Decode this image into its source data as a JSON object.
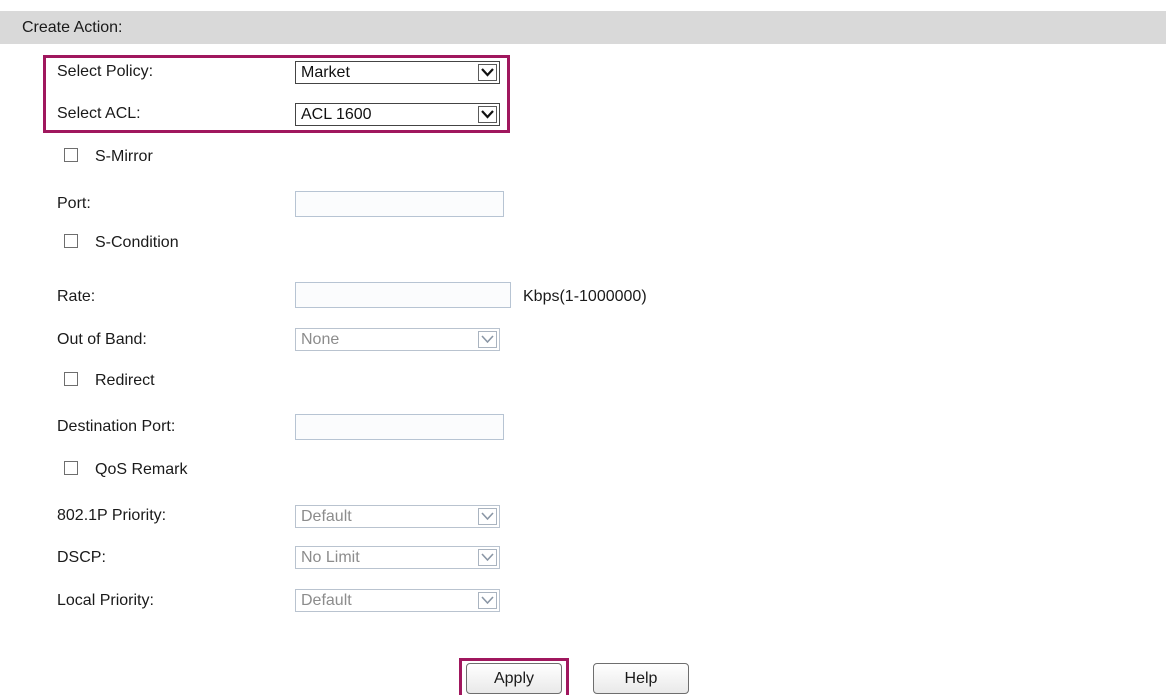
{
  "section": {
    "title": "Create Action:"
  },
  "form": {
    "select_policy": {
      "label": "Select Policy:",
      "value": "Market"
    },
    "select_acl": {
      "label": "Select ACL:",
      "value": "ACL 1600"
    },
    "s_mirror": {
      "label": "S-Mirror",
      "checked": false
    },
    "port": {
      "label": "Port:",
      "value": ""
    },
    "s_condition": {
      "label": "S-Condition",
      "checked": false
    },
    "rate": {
      "label": "Rate:",
      "value": "",
      "unit": "Kbps(1-1000000)"
    },
    "out_of_band": {
      "label": "Out of Band:",
      "value": "None"
    },
    "redirect": {
      "label": "Redirect",
      "checked": false
    },
    "destination_port": {
      "label": "Destination Port:",
      "value": ""
    },
    "qos_remark": {
      "label": "QoS Remark",
      "checked": false
    },
    "priority_8021p": {
      "label": "802.1P Priority:",
      "value": "Default"
    },
    "dscp": {
      "label": "DSCP:",
      "value": "No Limit"
    },
    "local_priority": {
      "label": "Local Priority:",
      "value": "Default"
    }
  },
  "buttons": {
    "apply": "Apply",
    "help": "Help"
  },
  "colors": {
    "highlight": "#a0175e",
    "header_bg": "#d9d9d9",
    "disabled_text": "#8c8c8c"
  },
  "icons": {
    "dropdown": "chevron-down-icon"
  }
}
